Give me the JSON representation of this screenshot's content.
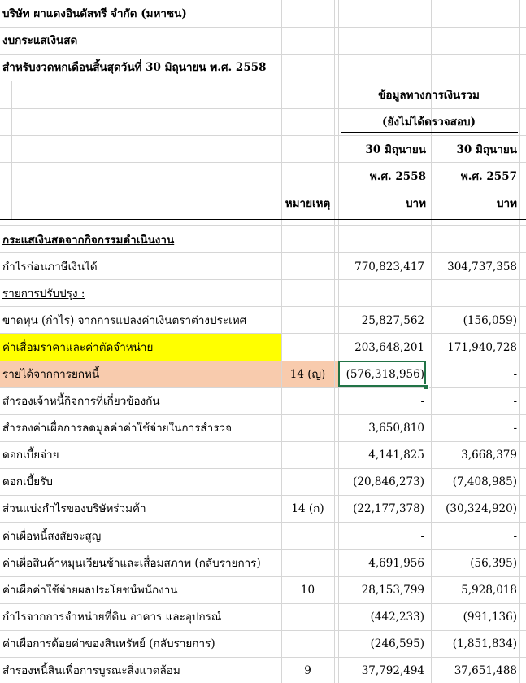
{
  "header": {
    "company": "บริษัท ผาแดงอินดัสทรี จำกัด (มหาชน)",
    "statement": "งบกระแสเงินสด",
    "period": "สำหรับงวดหกเดือนสิ้นสุดวันที่ 30 มิถุนายน พ.ศ. 2558"
  },
  "columns": {
    "group_title": "ข้อมูลทางการเงินรวม",
    "group_sub": "(ยังไม่ได้ตรวจสอบ)",
    "col1_date": "30 มิถุนายน",
    "col1_year": "พ.ศ. 2558",
    "col1_unit": "บาท",
    "col2_date": "30 มิถุนายน",
    "col2_year": "พ.ศ. 2557",
    "col2_unit": "บาท",
    "note_header": "หมายเหตุ"
  },
  "section": {
    "operating": "กระแสเงินสดจากกิจกรรมดำเนินงาน",
    "adjustments": "รายการปรับปรุง :"
  },
  "rows": [
    {
      "label": "กำไรก่อนภาษีเงินได้",
      "note": "",
      "v2558": "770,823,417",
      "v2557": "304,737,358"
    },
    {
      "label": "ขาดทุน (กำไร) จากการแปลงค่าเงินตราต่างประเทศ",
      "note": "",
      "v2558": "25,827,562",
      "v2557": "(156,059)"
    },
    {
      "label": "ค่าเสื่อมราคาและค่าตัดจำหน่าย",
      "note": "",
      "v2558": "203,648,201",
      "v2557": "171,940,728"
    },
    {
      "label": "รายได้จากการยกหนี้",
      "note": "14 (ญ)",
      "v2558": "(576,318,956)",
      "v2557": "-"
    },
    {
      "label": "สำรองเจ้าหนี้กิจการที่เกี่ยวข้องกัน",
      "note": "",
      "v2558": "-",
      "v2557": "-"
    },
    {
      "label": "สำรองค่าเผื่อการลดมูลค่าค่าใช้จ่ายในการสำรวจ",
      "note": "",
      "v2558": "3,650,810",
      "v2557": "-"
    },
    {
      "label": "ดอกเบี้ยจ่าย",
      "note": "",
      "v2558": "4,141,825",
      "v2557": "3,668,379"
    },
    {
      "label": "ดอกเบี้ยรับ",
      "note": "",
      "v2558": "(20,846,273)",
      "v2557": "(7,408,985)"
    },
    {
      "label": "ส่วนแบ่งกำไรของบริษัทร่วมค้า",
      "note": "14 (ก)",
      "v2558": "(22,177,378)",
      "v2557": "(30,324,920)"
    },
    {
      "label": "ค่าเผื่อหนี้สงสัยจะสูญ",
      "note": "",
      "v2558": "-",
      "v2557": "-"
    },
    {
      "label": "ค่าเผื่อสินค้าหมุนเวียนช้าและเสื่อมสภาพ (กลับรายการ)",
      "note": "",
      "v2558": "4,691,956",
      "v2557": "(56,395)"
    },
    {
      "label": "ค่าเผื่อค่าใช้จ่ายผลประโยชน์พนักงาน",
      "note": "10",
      "v2558": "28,153,799",
      "v2557": "5,928,018"
    },
    {
      "label": "กำไรจากการจำหน่ายที่ดิน อาคาร และอุปกรณ์",
      "note": "",
      "v2558": "(442,233)",
      "v2557": "(991,136)"
    },
    {
      "label": "ค่าเผื่อการด้อยค่าของสินทรัพย์ (กลับรายการ)",
      "note": "",
      "v2558": "(246,595)",
      "v2557": "(1,851,834)"
    },
    {
      "label": "สำรองหนี้สินเพื่อการบูรณะสิ่งแวดล้อม",
      "note": "9",
      "v2558": "37,792,494",
      "v2557": "37,651,488"
    }
  ],
  "colors": {
    "highlight_yellow": "#ffff00",
    "highlight_peach": "#f8cbad",
    "selection": "#217346",
    "gridline": "#d6d6d6"
  }
}
